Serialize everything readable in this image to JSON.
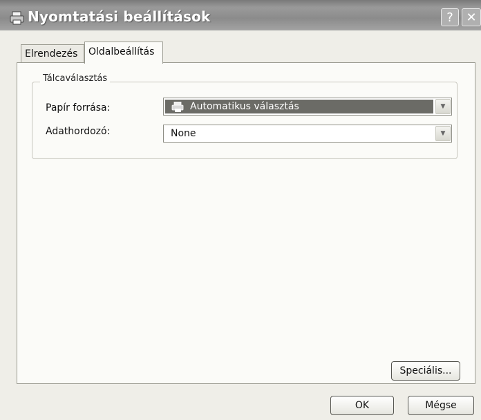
{
  "window": {
    "title": "Nyomtatási beállítások",
    "help_label": "?",
    "close_label": "✕"
  },
  "tabs": [
    {
      "label": "Elrendezés",
      "selected": false
    },
    {
      "label": "Oldalbeállítás",
      "selected": true
    }
  ],
  "tray_group": {
    "title": "Tálcaválasztás",
    "paper_source": {
      "label": "Papír forrása:",
      "value": "Automatikus választás",
      "icon": "printer-icon"
    },
    "media": {
      "label": "Adathordozó:",
      "value": "None"
    }
  },
  "buttons": {
    "special": "Speciális...",
    "ok": "OK",
    "cancel": "Mégse"
  },
  "colors": {
    "selection": "#6b6b66",
    "titlebar": "#8b8b8b"
  }
}
